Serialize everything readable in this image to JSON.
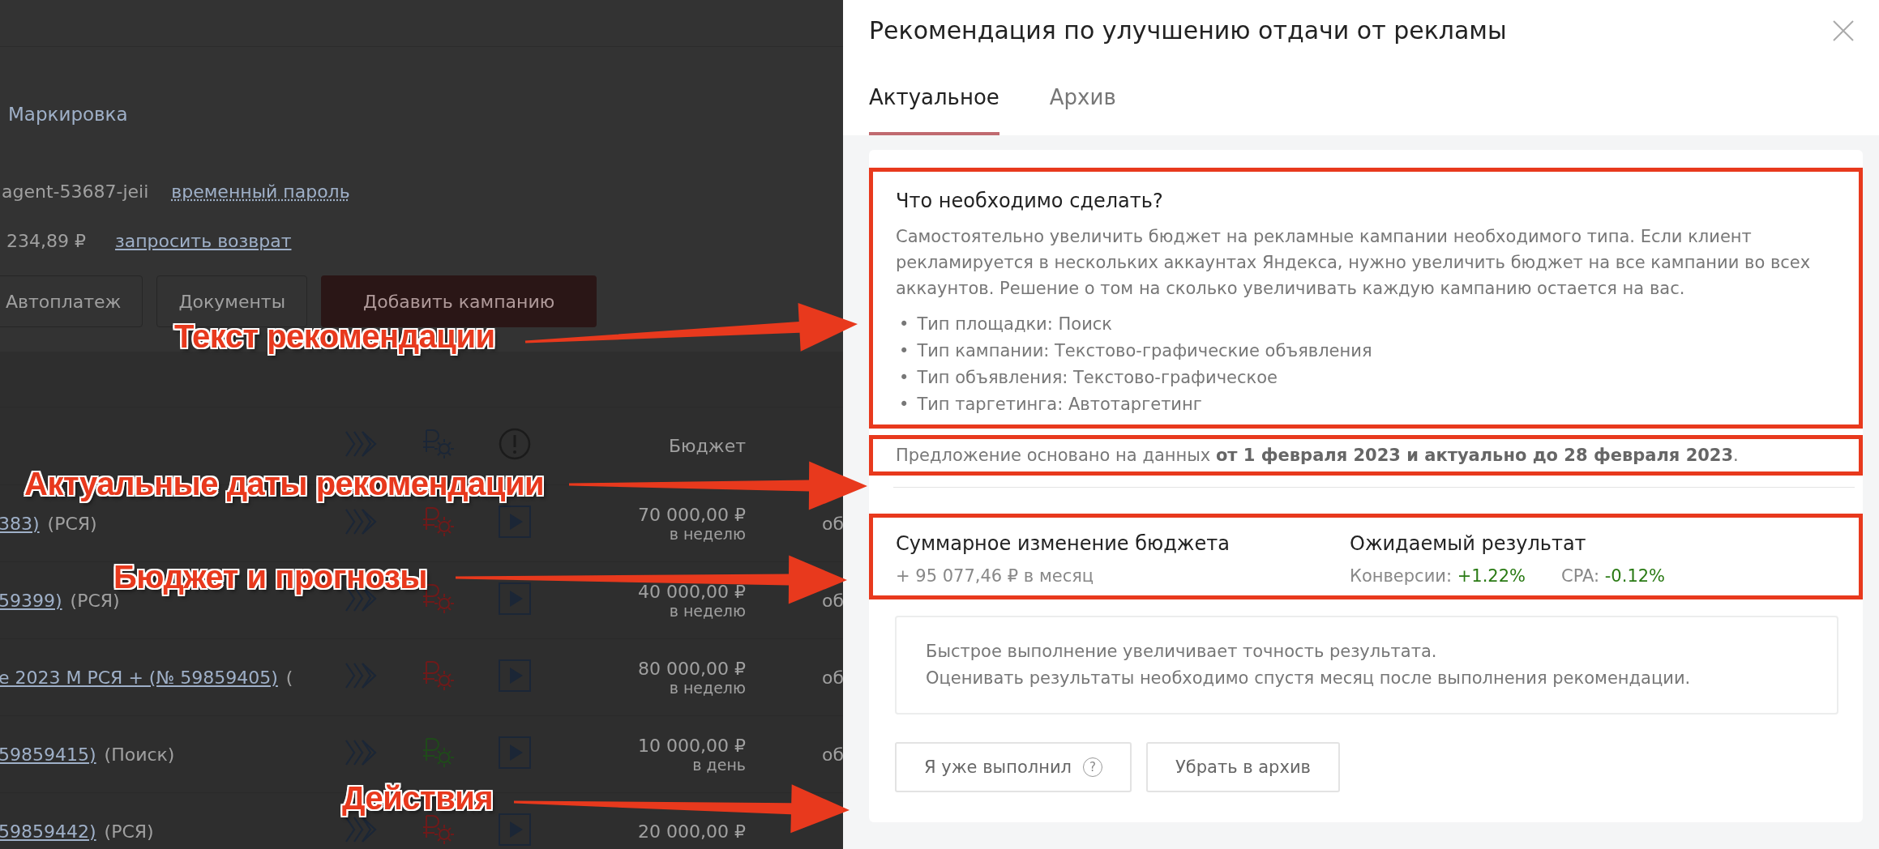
{
  "background_page": {
    "menu_item": "Маркировка",
    "login": "agent-53687-jeii",
    "password_link": "временный пароль",
    "balance": "234,89 ₽",
    "refund_link": "запросить возврат",
    "buttons": [
      {
        "label": "Автоплатеж",
        "kind": "outline"
      },
      {
        "label": "Документы",
        "kind": "outline"
      },
      {
        "label": "Добавить кампанию",
        "kind": "primary"
      }
    ],
    "table": {
      "budget_header": "Бюджет",
      "rows": [
        {
          "campaign": "383)",
          "type": "(РСЯ)",
          "color": "#6e1a1a",
          "budget": "70 000,00 ₽",
          "period": "в неделю",
          "column_7": "об"
        },
        {
          "campaign": "59399)",
          "type": "(РСЯ)",
          "color": "#6e1a1a",
          "budget": "40 000,00 ₽",
          "period": "в неделю",
          "column_7": "об"
        },
        {
          "campaign": "е 2023 М РСЯ + (№ 59859405)",
          "type": "(",
          "color": "#6e1a1a",
          "budget": "80 000,00 ₽",
          "period": "в неделю",
          "column_7": "об"
        },
        {
          "campaign": "59859415)",
          "type": "(Поиск)",
          "color": "#1f4a1a",
          "budget": "10 000,00 ₽",
          "period": "в день",
          "column_7": "об"
        },
        {
          "campaign": "59859442)",
          "type": "(РСЯ)",
          "color": "#6e1a1a",
          "budget": "20 000,00 ₽"
        }
      ]
    }
  },
  "panel": {
    "title": "Рекомендация по улучшению отдачи от рекламы",
    "tabs": [
      {
        "label": "Актуальное",
        "selected": true
      },
      {
        "label": "Архив",
        "selected": false
      }
    ],
    "todo": {
      "heading": "Что необходимо сделать?",
      "text": "Самостоятельно увеличить бюджет на рекламные кампании необходимого типа. Если клиент рекламируется в нескольких аккаунтах Яндекса, нужно увеличить бюджет на все кампании во всех аккаунтов. Решение о том на сколько увеличивать каждую кампанию остается на вас.",
      "bullet_marker": "•",
      "bullets": [
        "Тип площадки: Поиск",
        "Тип кампании: Текстово-графические объявления",
        "Тип объявления: Текстово-графическое",
        "Тип таргетинга: Автотаргетинг"
      ]
    },
    "dates": "Предложение основано на данных **от 1 февраля 2023 и актуально до 28 февраля 2023**.",
    "budget": {
      "heading": "Суммарное изменение бюджета",
      "value": "+ 95 077,46 ₽ в месяц"
    },
    "result": {
      "heading": "Ожидаемый результат",
      "metrics": [
        {
          "label": "Конверсии:",
          "value": "+1.22%"
        },
        {
          "label": "CPA:",
          "value": "-0.12%"
        }
      ]
    },
    "info_lines": [
      "Быстрое выполнение увеличивает точность результата.",
      "Оценивать результаты необходимо спустя месяц после выполнения рекомендации."
    ],
    "actions": [
      {
        "label": "Я уже выполнил",
        "help": "?"
      },
      {
        "label": "Убрать в архив"
      }
    ]
  },
  "annotations": [
    {
      "label": "Текст рекомендации"
    },
    {
      "label": "Актуальные даты рекомендации"
    },
    {
      "label": "Бюджет и прогнозы"
    },
    {
      "label": "Действия"
    }
  ]
}
